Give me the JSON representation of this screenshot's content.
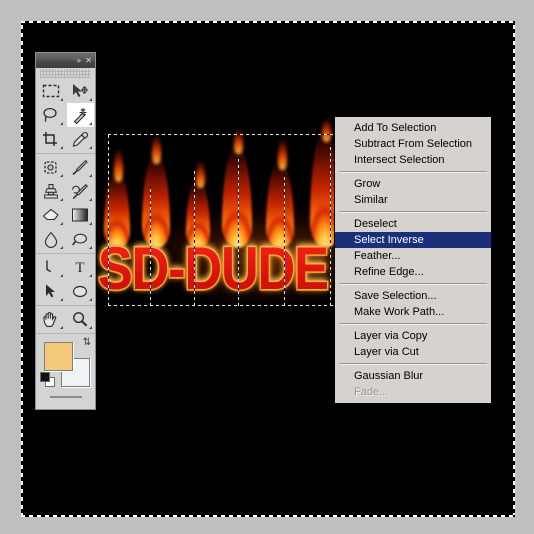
{
  "app": {
    "background_color": "#c0c0c0",
    "canvas_color": "#000000"
  },
  "canvas": {
    "name": "image-canvas",
    "selection_active": true
  },
  "artwork": {
    "text": "SD-DUDE",
    "style": "flaming-text",
    "fill_color": "#e01b10",
    "stroke_color": "#c8901c",
    "flame_colors": [
      "#ffd257",
      "#ff9c18",
      "#f4600a",
      "#c62600",
      "#7d1300"
    ]
  },
  "toolbox": {
    "title_collapse": "»",
    "title_close": "✕",
    "tools": [
      {
        "name": "rectangular-marquee-tool",
        "selected": false
      },
      {
        "name": "move-tool",
        "selected": false
      },
      {
        "name": "lasso-tool",
        "selected": false
      },
      {
        "name": "magic-wand-tool",
        "selected": true
      },
      {
        "name": "crop-tool",
        "selected": false
      },
      {
        "name": "eyedropper-tool",
        "selected": false
      },
      {
        "name": "healing-brush-tool",
        "selected": false
      },
      {
        "name": "brush-tool",
        "selected": false
      },
      {
        "name": "clone-stamp-tool",
        "selected": false
      },
      {
        "name": "history-brush-tool",
        "selected": false
      },
      {
        "name": "eraser-tool",
        "selected": false
      },
      {
        "name": "gradient-tool",
        "selected": false
      },
      {
        "name": "blur-tool",
        "selected": false
      },
      {
        "name": "dodge-tool",
        "selected": false
      },
      {
        "name": "pen-tool",
        "selected": false
      },
      {
        "name": "type-tool",
        "selected": false
      },
      {
        "name": "path-selection-tool",
        "selected": false
      },
      {
        "name": "ellipse-shape-tool",
        "selected": false
      },
      {
        "name": "hand-tool",
        "selected": false
      },
      {
        "name": "zoom-tool",
        "selected": false
      }
    ],
    "foreground_color": "#f5c97a",
    "background_color": "#eef4f6",
    "swap_icon": "⇅"
  },
  "context_menu": {
    "name": "selection-context-menu",
    "highlighted": "Select Inverse",
    "groups": [
      {
        "items": [
          {
            "label": "Add To Selection",
            "disabled": false
          },
          {
            "label": "Subtract From Selection",
            "disabled": false
          },
          {
            "label": "Intersect Selection",
            "disabled": false
          }
        ]
      },
      {
        "items": [
          {
            "label": "Grow",
            "disabled": false
          },
          {
            "label": "Similar",
            "disabled": false
          }
        ]
      },
      {
        "items": [
          {
            "label": "Deselect",
            "disabled": false
          },
          {
            "label": "Select Inverse",
            "disabled": false,
            "highlighted": true
          },
          {
            "label": "Feather...",
            "disabled": false
          },
          {
            "label": "Refine Edge...",
            "disabled": false
          }
        ]
      },
      {
        "items": [
          {
            "label": "Save Selection...",
            "disabled": false
          },
          {
            "label": "Make Work Path...",
            "disabled": false
          }
        ]
      },
      {
        "items": [
          {
            "label": "Layer via Copy",
            "disabled": false
          },
          {
            "label": "Layer via Cut",
            "disabled": false
          }
        ]
      },
      {
        "items": [
          {
            "label": "Gaussian Blur",
            "disabled": false
          },
          {
            "label": "Fade...",
            "disabled": true
          }
        ]
      }
    ],
    "highlight_color": "#1a2f7a",
    "menu_bg_color": "#d6d3ce"
  }
}
